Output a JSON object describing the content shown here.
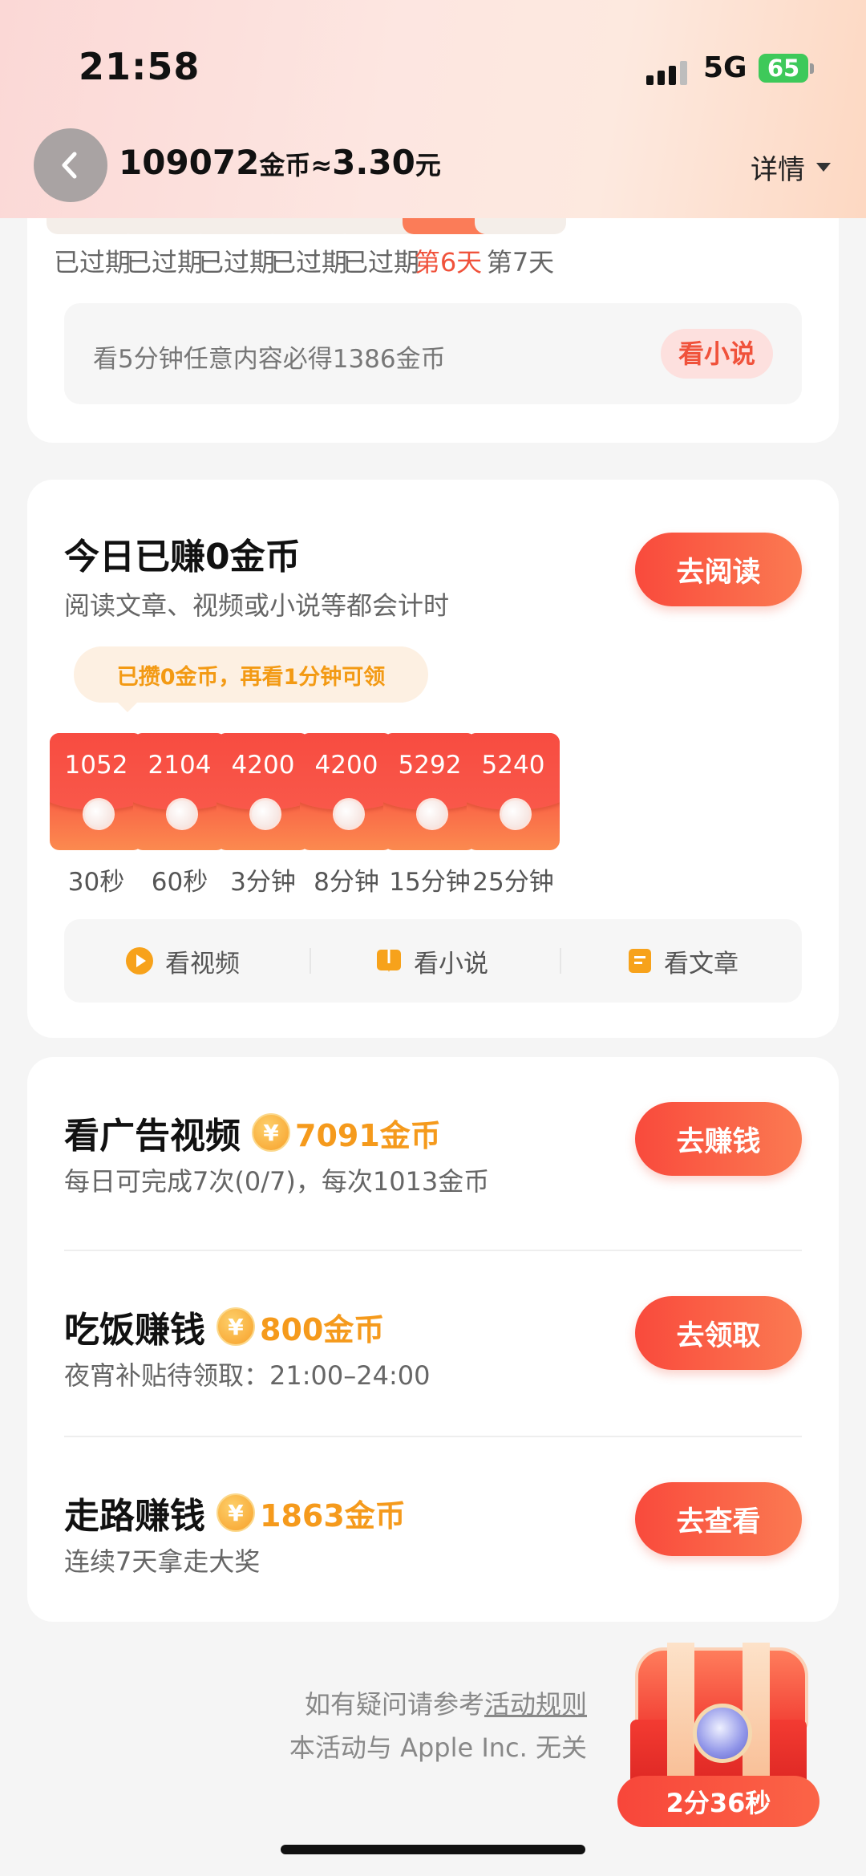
{
  "status_bar": {
    "time": "21:58",
    "network": "5G",
    "battery": "65"
  },
  "header": {
    "coins": "109072",
    "coin_unit": "金币",
    "approx": "≈",
    "cash": "3.30",
    "cash_unit": "元",
    "details_label": "详情"
  },
  "checkin": {
    "days": [
      {
        "label": "已过期",
        "active": false
      },
      {
        "label": "已过期",
        "active": false
      },
      {
        "label": "已过期",
        "active": false
      },
      {
        "label": "已过期",
        "active": false
      },
      {
        "label": "已过期",
        "active": false
      },
      {
        "label": "第6天",
        "active": true
      },
      {
        "label": "第7天",
        "active": false
      }
    ],
    "notice": "看5分钟任意内容必得1386金币",
    "notice_button": "看小说"
  },
  "reading": {
    "title": "今日已赚0金币",
    "subtitle": "阅读文章、视频或小说等都会计时",
    "button": "去阅读",
    "tip": "已攒0金币，再看1分钟可领",
    "rewards": [
      {
        "amount": "1052",
        "time": "30秒"
      },
      {
        "amount": "2104",
        "time": "60秒"
      },
      {
        "amount": "4200",
        "time": "3分钟"
      },
      {
        "amount": "4200",
        "time": "8分钟"
      },
      {
        "amount": "5292",
        "time": "15分钟"
      },
      {
        "amount": "5240",
        "time": "25分钟"
      }
    ],
    "tabs": [
      {
        "label": "看视频",
        "icon": "play-icon"
      },
      {
        "label": "看小说",
        "icon": "book-icon"
      },
      {
        "label": "看文章",
        "icon": "article-icon"
      }
    ]
  },
  "tasks": [
    {
      "title": "看广告视频",
      "reward": "7091金币",
      "desc": "每日可完成7次(0/7)，每次1013金币",
      "button": "去赚钱"
    },
    {
      "title": "吃饭赚钱",
      "reward": "800金币",
      "desc": "夜宵补贴待领取：21:00–24:00",
      "button": "去领取"
    },
    {
      "title": "走路赚钱",
      "reward": "1863金币",
      "desc": "连续7天拿走大奖",
      "button": "去查看"
    }
  ],
  "coin_symbol": "¥",
  "footer": {
    "line1_prefix": "如有疑问请参考",
    "rules_link": "活动规则",
    "line2": "本活动与 Apple Inc. 无关"
  },
  "chest": {
    "timer": "2分36秒"
  },
  "colors": {
    "accent_red": "#f0523b",
    "orange": "#f59a1c",
    "battery_green": "#3ec95a"
  }
}
